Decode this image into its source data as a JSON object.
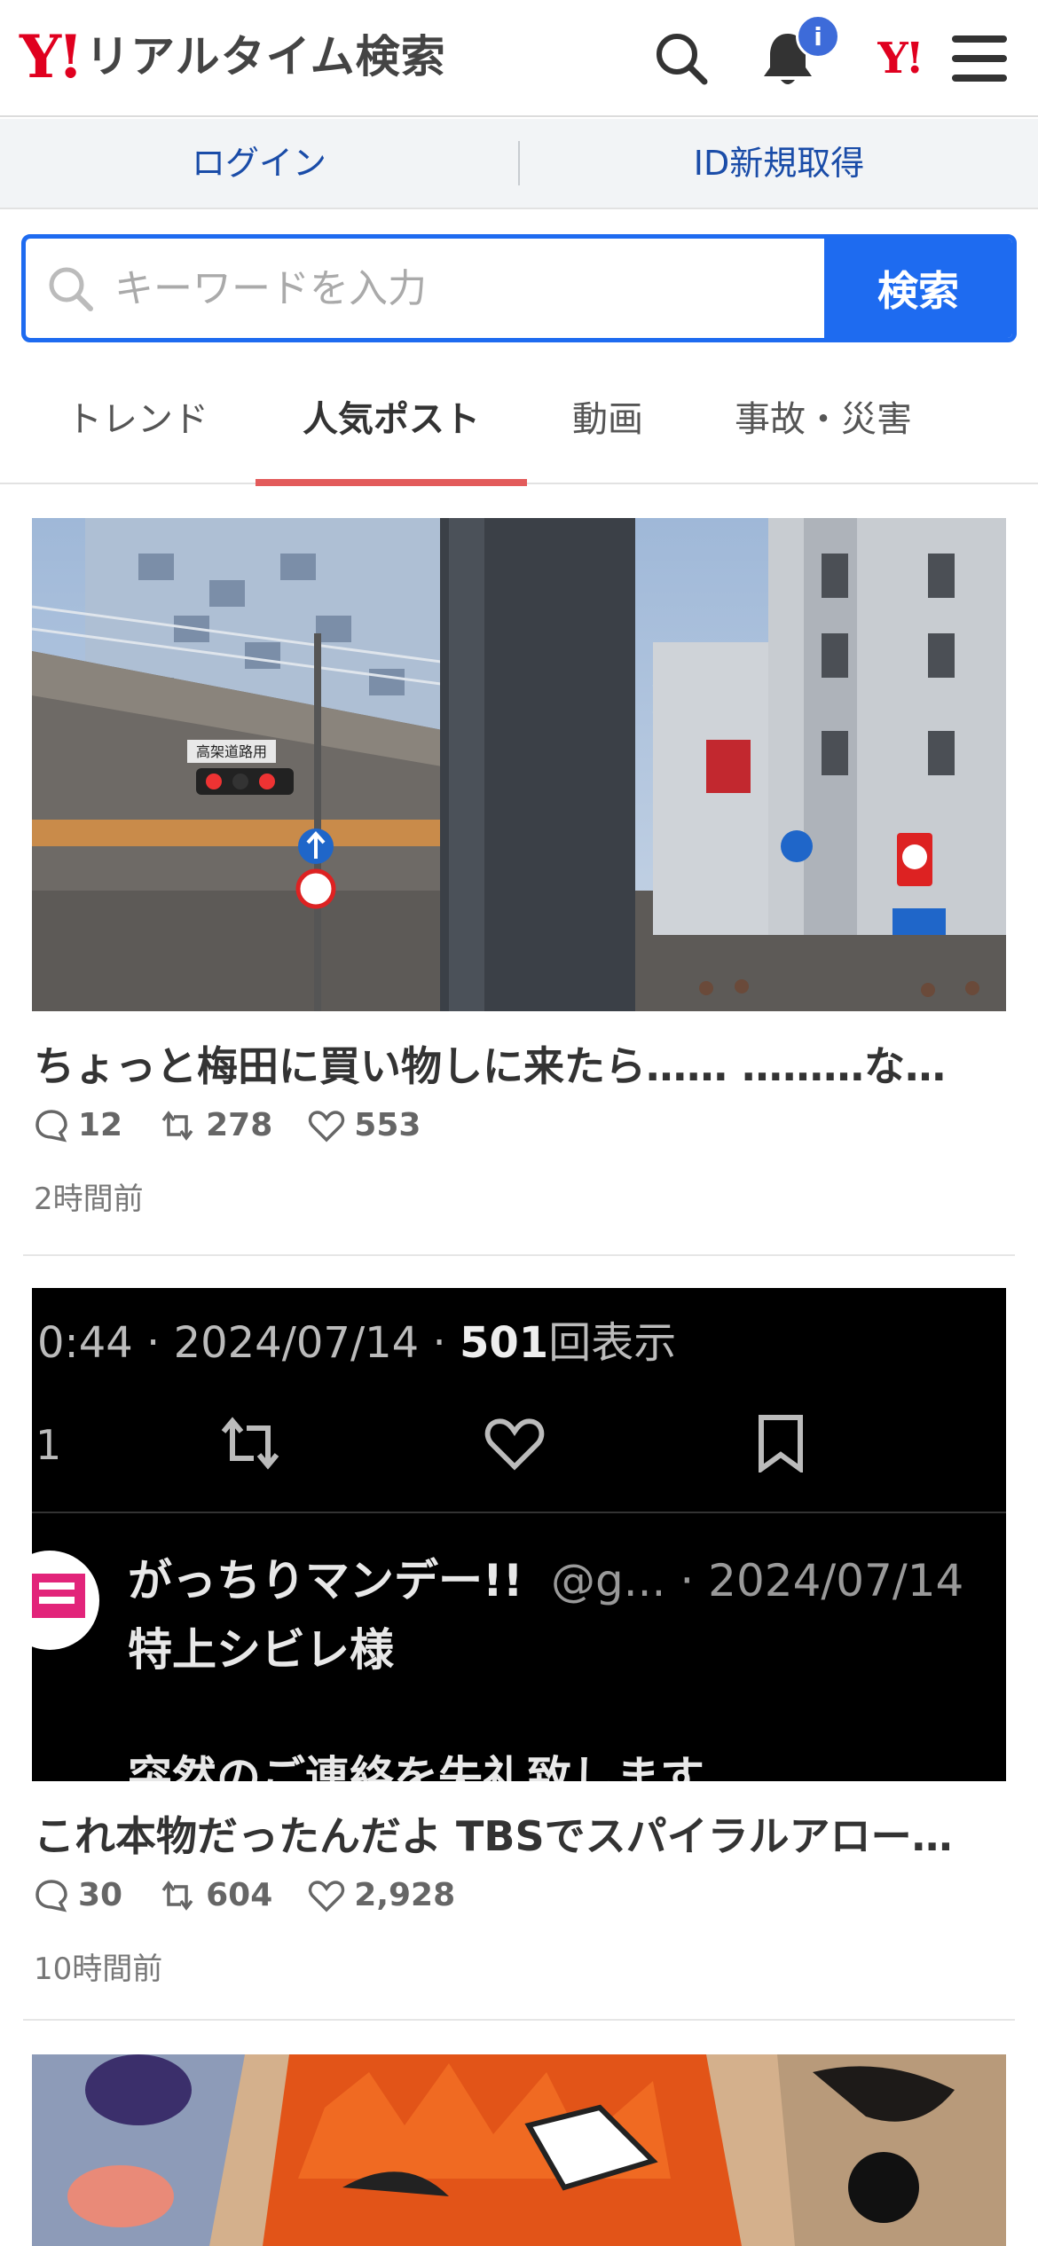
{
  "header": {
    "logo_mark": "Y!",
    "title": "リアルタイム検索",
    "notification_badge": "i",
    "yahoo_mini": "Y!"
  },
  "login_bar": {
    "login": "ログイン",
    "signup": "ID新規取得"
  },
  "search": {
    "placeholder": "キーワードを入力",
    "button": "検索"
  },
  "tabs": [
    {
      "label": "トレンド",
      "active": false
    },
    {
      "label": "人気ポスト",
      "active": true
    },
    {
      "label": "動画",
      "active": false
    },
    {
      "label": "事故・災害",
      "active": false
    }
  ],
  "posts": [
    {
      "title": "ちょっと梅田に買い物しに来たら…… ………な…",
      "replies": "12",
      "reposts": "278",
      "likes": "553",
      "time": "2時間前",
      "sign_text": "高架道路用"
    },
    {
      "title": "これ本物だったんだよ TBSでスパイラルアロー…",
      "replies": "30",
      "reposts": "604",
      "likes": "2,928",
      "time": "10時間前",
      "screenshot": {
        "meta_line_prefix": "0:44 · 2024/07/14 · ",
        "views": "501",
        "views_suffix": "回表示",
        "left_digit": "1",
        "author": "がっちりマンデー!!",
        "handle_date": "@g... · 2024/07/14",
        "line1": "特上シビレ様",
        "line2": "突然のご連絡を失礼致します。"
      }
    }
  ],
  "colors": {
    "yahoo_red": "#e0001f",
    "search_blue": "#1e6bf0",
    "login_link": "#1a4ca8",
    "tab_underline": "#e35b5b",
    "badge_blue": "#3d6bd9"
  }
}
